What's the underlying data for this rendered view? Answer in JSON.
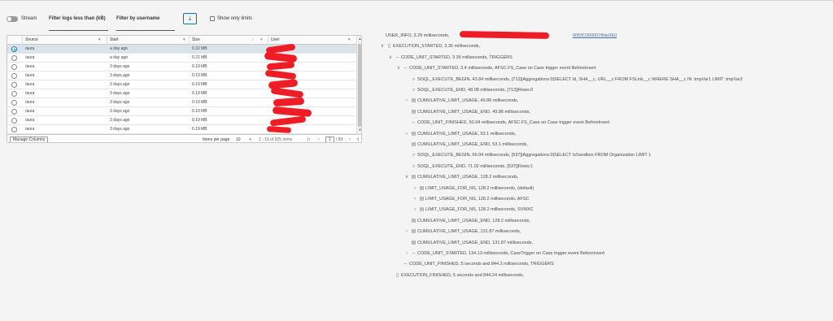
{
  "toolbar": {
    "stream_label": "Stream",
    "filter_size_label": "Filter logs less than (kB)",
    "filter_user_label": "Filter by username",
    "download_icon": "download-icon",
    "show_only_limits_label": "Show only limits"
  },
  "grid": {
    "columns": [
      "Source",
      "Start",
      "Size",
      "User"
    ],
    "rows": [
      {
        "source": "/aura",
        "start": "a day ago",
        "size": "0.32 MB",
        "selected": true
      },
      {
        "source": "/aura",
        "start": "a day ago",
        "size": "0.21 MB",
        "selected": false
      },
      {
        "source": "/aura",
        "start": "3 days ago",
        "size": "0.19 MB",
        "selected": false
      },
      {
        "source": "/aura",
        "start": "3 days ago",
        "size": "0.19 MB",
        "selected": false
      },
      {
        "source": "/aura",
        "start": "3 days ago",
        "size": "0.19 MB",
        "selected": false
      },
      {
        "source": "/aura",
        "start": "3 days ago",
        "size": "0.19 MB",
        "selected": false
      },
      {
        "source": "/aura",
        "start": "3 days ago",
        "size": "0.19 MB",
        "selected": false
      },
      {
        "source": "/aura",
        "start": "3 days ago",
        "size": "0.19 MB",
        "selected": false
      },
      {
        "source": "/aura",
        "start": "3 days ago",
        "size": "0.19 MB",
        "selected": false
      },
      {
        "source": "/aura",
        "start": "3 days ago",
        "size": "0.19 MB",
        "selected": false
      }
    ],
    "footer": {
      "manage_columns": "Manage Columns",
      "items_per_page_label": "Items per page",
      "items_per_page_value": "10",
      "range": "1 - 10 of 925 items",
      "page_input": "1",
      "page_total": "/ 93"
    }
  },
  "tree": [
    {
      "indent": 0,
      "chevron": "",
      "icon": "",
      "text": "USER_INFO, 3.29 milliseconds,",
      "link": "0050C000007tNwXEi)"
    },
    {
      "indent": 0,
      "chevron": "∨",
      "icon": "doc-icon",
      "text": "EXECUTION_STARTED, 3.35 milliseconds,"
    },
    {
      "indent": 1,
      "chevron": "∨",
      "icon": "code-icon",
      "text": "CODE_UNIT_STARTED, 3.36 milliseconds, TRIGGERS"
    },
    {
      "indent": 2,
      "chevron": "∨",
      "icon": "code-icon",
      "text": "CODE_UNIT_STARTED, 3.4 milliseconds, AFSC.FS_Case on Case trigger event BeforeInsert"
    },
    {
      "indent": 3,
      "chevron": "",
      "icon": "search-icon",
      "text": "SOQL_EXECUTE_BEGIN, 43.84 milliseconds, [712]|Aggregations:0|SELECT Id, SHA__c, URL__c FROM FSLink__c WHERE SHA__c IN :tmpVar1 LIMIT :tmpVar2"
    },
    {
      "indent": 3,
      "chevron": "",
      "icon": "search-icon",
      "text": "SOQL_EXECUTE_END, 48.08 milliseconds, [712]|Rows:0"
    },
    {
      "indent": 3,
      "chevron": "›",
      "icon": "table-icon",
      "text": "CUMULATIVE_LIMIT_USAGE, 49.86 milliseconds,"
    },
    {
      "indent": 3,
      "chevron": "",
      "icon": "table-icon",
      "text": "CUMULATIVE_LIMIT_USAGE_END, 49.86 milliseconds,"
    },
    {
      "indent": 3,
      "chevron": "",
      "icon": "code-icon",
      "text": "CODE_UNIT_FINISHED, 50.04 milliseconds, AFSC.FS_Case on Case trigger event BeforeInsert"
    },
    {
      "indent": 3,
      "chevron": "›",
      "icon": "table-icon",
      "text": "CUMULATIVE_LIMIT_USAGE, 53.1 milliseconds,"
    },
    {
      "indent": 3,
      "chevron": "",
      "icon": "table-icon",
      "text": "CUMULATIVE_LIMIT_USAGE_END, 53.1 milliseconds,"
    },
    {
      "indent": 3,
      "chevron": "",
      "icon": "search-icon",
      "text": "SOQL_EXECUTE_BEGIN, 66.04 milliseconds, [537]|Aggregations:0|SELECT IsSandbox FROM Organization LIMIT 1"
    },
    {
      "indent": 3,
      "chevron": "",
      "icon": "search-icon",
      "text": "SOQL_EXECUTE_END, 71.02 milliseconds, [537]|Rows:1"
    },
    {
      "indent": 3,
      "chevron": "∨",
      "icon": "table-icon",
      "text": "CUMULATIVE_LIMIT_USAGE, 128.2 milliseconds,"
    },
    {
      "indent": 4,
      "chevron": "›",
      "icon": "table-icon",
      "text": "LIMIT_USAGE_FOR_NS, 128.2 milliseconds, (default)"
    },
    {
      "indent": 4,
      "chevron": "›",
      "icon": "table-icon",
      "text": "LIMIT_USAGE_FOR_NS, 128.2 milliseconds, AFSC"
    },
    {
      "indent": 4,
      "chevron": "›",
      "icon": "table-icon",
      "text": "LIMIT_USAGE_FOR_NS, 128.2 milliseconds, SVMXC"
    },
    {
      "indent": 3,
      "chevron": "",
      "icon": "table-icon",
      "text": "CUMULATIVE_LIMIT_USAGE_END, 128.2 milliseconds,"
    },
    {
      "indent": 3,
      "chevron": "›",
      "icon": "table-icon",
      "text": "CUMULATIVE_LIMIT_USAGE, 131.87 milliseconds,"
    },
    {
      "indent": 3,
      "chevron": "",
      "icon": "table-icon",
      "text": "CUMULATIVE_LIMIT_USAGE_END, 131.87 milliseconds,"
    },
    {
      "indent": 3,
      "chevron": "›",
      "icon": "code-icon",
      "text": "CODE_UNIT_STARTED, 134.13 milliseconds, CaseTrigger on Case trigger event BeforeInsert"
    },
    {
      "indent": 2,
      "chevron": "",
      "icon": "code-icon",
      "text": "CODE_UNIT_FINISHED, 5 seconds and 844.2 milliseconds, TRIGGERS"
    },
    {
      "indent": 1,
      "chevron": "",
      "icon": "doc-icon",
      "text": "EXECUTION_FINISHED, 5 seconds and 844.24 milliseconds,"
    }
  ]
}
